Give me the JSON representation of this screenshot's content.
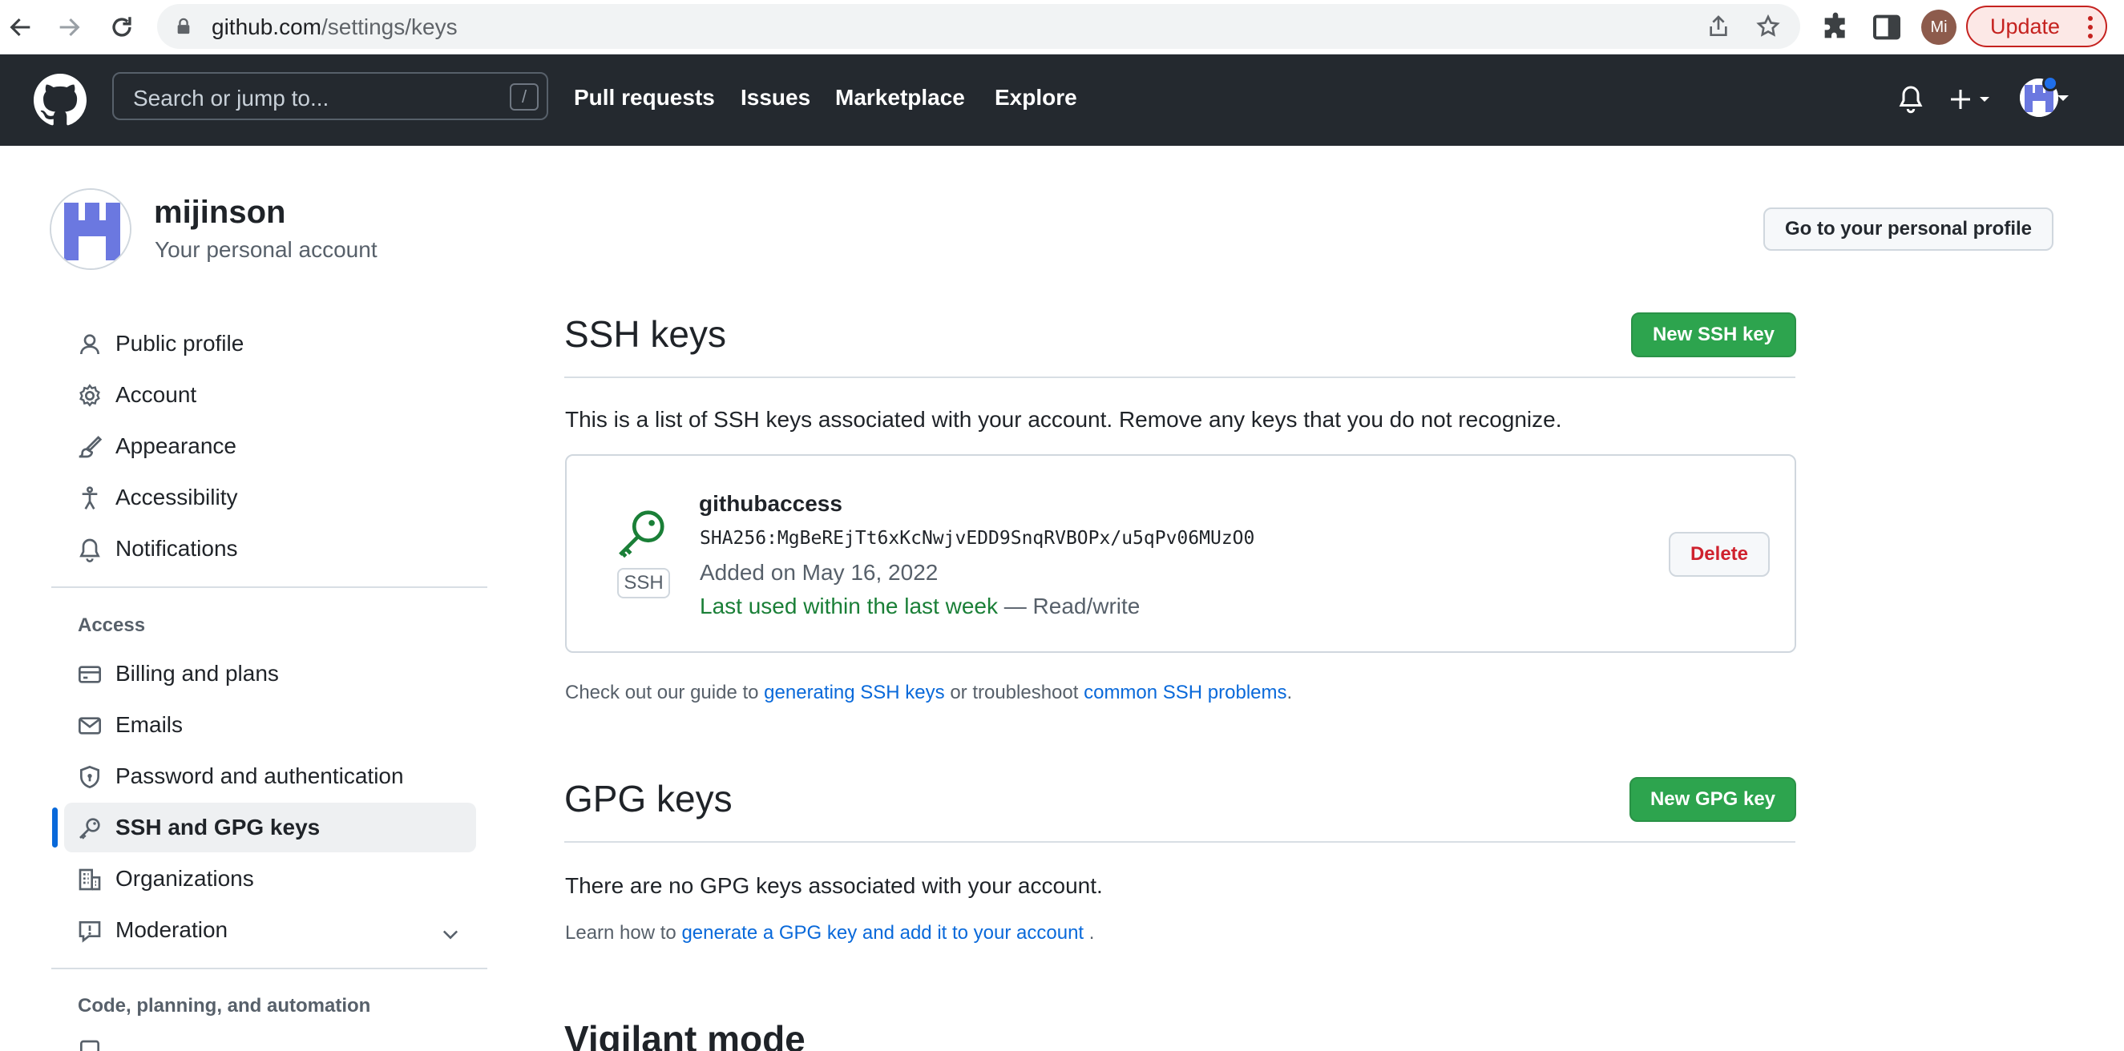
{
  "browser": {
    "url_host": "github.com",
    "url_path": "/settings/keys",
    "profile_initials": "Mi",
    "update_label": "Update"
  },
  "header": {
    "search_placeholder": "Search or jump to...",
    "search_shortcut": "/",
    "nav": [
      "Pull requests",
      "Issues",
      "Marketplace",
      "Explore"
    ]
  },
  "account": {
    "name": "mijinson",
    "subtitle": "Your personal account",
    "profile_button": "Go to your personal profile"
  },
  "sidebar": {
    "items": [
      {
        "label": "Public profile",
        "icon": "person-icon"
      },
      {
        "label": "Account",
        "icon": "gear-icon"
      },
      {
        "label": "Appearance",
        "icon": "paintbrush-icon"
      },
      {
        "label": "Accessibility",
        "icon": "accessibility-icon"
      },
      {
        "label": "Notifications",
        "icon": "bell-icon"
      }
    ],
    "access_heading": "Access",
    "access_items": [
      {
        "label": "Billing and plans",
        "icon": "credit-card-icon"
      },
      {
        "label": "Emails",
        "icon": "mail-icon"
      },
      {
        "label": "Password and authentication",
        "icon": "shield-lock-icon"
      },
      {
        "label": "SSH and GPG keys",
        "icon": "key-icon",
        "active": true
      },
      {
        "label": "Organizations",
        "icon": "organization-icon"
      },
      {
        "label": "Moderation",
        "icon": "report-icon"
      }
    ],
    "code_heading": "Code, planning, and automation"
  },
  "ssh": {
    "title": "SSH keys",
    "new_button": "New SSH key",
    "description": "This is a list of SSH keys associated with your account. Remove any keys that you do not recognize.",
    "keys": [
      {
        "type_badge": "SSH",
        "title": "githubaccess",
        "fingerprint": "SHA256:MgBeREjTt6xKcNwjvEDD9SnqRVBOPx/u5qPv06MUzO0",
        "added": "Added on May 16, 2022",
        "last_used": "Last used within the last week",
        "access": "— Read/write",
        "delete_label": "Delete"
      }
    ],
    "guide_prefix": "Check out our guide to",
    "guide_link1": "generating SSH keys",
    "guide_middle": "or troubleshoot",
    "guide_link2": "common SSH problems",
    "guide_suffix": "."
  },
  "gpg": {
    "title": "GPG keys",
    "new_button": "New GPG key",
    "empty_text": "There are no GPG keys associated with your account.",
    "learn_prefix": "Learn how to",
    "learn_link": "generate a GPG key and add it to your account",
    "learn_suffix": "."
  },
  "vigilant": {
    "title": "Vigilant mode"
  },
  "colors": {
    "header_bg": "#24292f",
    "primary_green": "#2da44e",
    "link_blue": "#0969da",
    "danger_red": "#cf222e",
    "success_green": "#1a7f37",
    "active_indicator": "#0969da"
  }
}
